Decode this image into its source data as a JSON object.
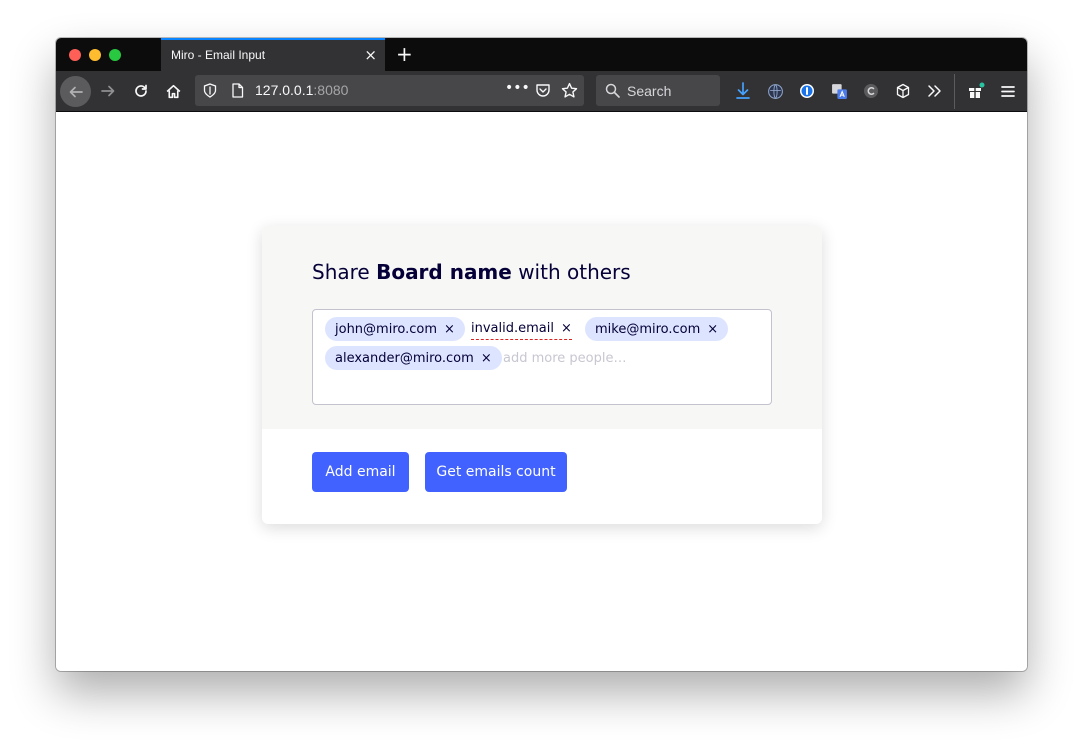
{
  "browser": {
    "tab_title": "Miro - Email Input",
    "tab_close": "×",
    "new_tab": "+",
    "url_host": "127.0.0.1",
    "url_port": ":8080",
    "search_placeholder": "Search",
    "page_actions": "•••"
  },
  "share": {
    "prefix": "Share ",
    "board_name": "Board name",
    "suffix": " with others"
  },
  "emails": [
    {
      "value": "john@miro.com",
      "valid": true
    },
    {
      "value": "invalid.email",
      "valid": false
    },
    {
      "value": "mike@miro.com",
      "valid": true
    },
    {
      "value": "alexander@miro.com",
      "valid": true
    }
  ],
  "chip_remove": "×",
  "input": {
    "placeholder": "add more people…",
    "value": ""
  },
  "buttons": {
    "add_email": "Add email",
    "get_count": "Get emails count"
  },
  "colors": {
    "accent": "#4262ff",
    "chip": "#dde4ff",
    "invalid_underline": "#d92321",
    "text": "#050038"
  }
}
